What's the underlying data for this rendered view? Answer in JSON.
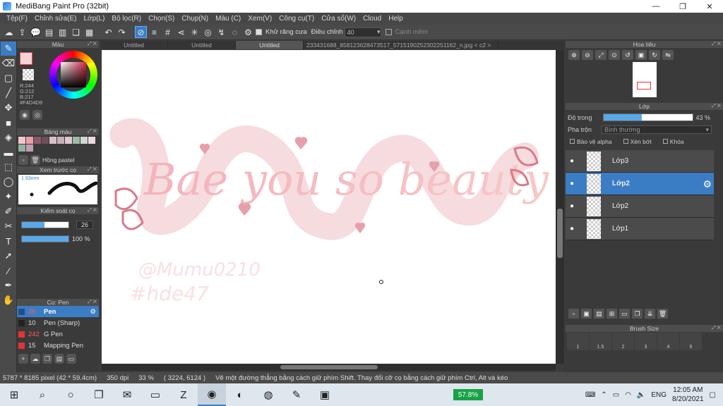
{
  "window": {
    "title": "MediBang Paint Pro (32bit)",
    "minimize": "—",
    "restore": "❐",
    "close": "✕"
  },
  "menu": [
    "Tệp(F)",
    "Chỉnh sửa(E)",
    "Lớp(L)",
    "Bộ lọc(R)",
    "Chọn(S)",
    "Chụp(N)",
    "Màu (C)",
    "Xem(V)",
    "Công cụ(T)",
    "Cửa sổ(W)",
    "Cloud",
    "Help"
  ],
  "toolbar": {
    "antialias_label": "Khử răng cưa",
    "correction_label": "Điều chỉnh",
    "correction_value": "40",
    "snap_label": "Cạnh mềm"
  },
  "panels": {
    "color": {
      "title": "Màu",
      "r": "R:244",
      "g": "G:212",
      "b": "B:217",
      "hex": "#F4D4D9"
    },
    "palette": {
      "title": "Bảng màu",
      "name": "Hồng pastel",
      "swatches": [
        "#f4c6cc",
        "#e8a0a8",
        "#8b5a6a",
        "#6b4f5a",
        "#d8c0c8",
        "#c8b0b8",
        "#e0c8d0",
        "#a0b8a8",
        "#d0d8d0",
        "#f0d8e0",
        "#90b0a0",
        "#c0a0b0"
      ]
    },
    "preview": {
      "title": "Xem trước cọ",
      "size": "1.93mm"
    },
    "control": {
      "title": "Kiểm soát cọ",
      "size_value": "26",
      "size_fraction": 0.48,
      "opacity_value": "100 %",
      "opacity_fraction": 1.0
    },
    "brushes": {
      "title": "Cọ: Pen",
      "items": [
        {
          "size": "26",
          "name": "Pen",
          "color": "#3b7dc4",
          "selected": true
        },
        {
          "size": "10",
          "name": "Pen (Sharp)",
          "color": "#222222",
          "selected": false
        },
        {
          "size": "242",
          "name": "G Pen",
          "color": "#e33333",
          "selected": false
        },
        {
          "size": "15",
          "name": "Mapping Pen",
          "color": "#e33333",
          "selected": false
        }
      ]
    }
  },
  "tabs": [
    {
      "label": "Untitled",
      "active": false
    },
    {
      "label": "Untitled",
      "active": false
    },
    {
      "label": "Untitled",
      "active": true
    },
    {
      "label": "233431688_858123628473517_5715190252302251162_n.jpg < c2 >",
      "active": false
    }
  ],
  "canvas_art": {
    "title_text": "Bae you so beauty",
    "signature": "@Mumu0210",
    "hashtag": "#hde47"
  },
  "right": {
    "navigator_title": "Hoa tiêu",
    "layer_title": "Lớp",
    "opacity_label": "Độ trong",
    "opacity_value": "43 %",
    "opacity_fraction": 0.43,
    "blend_label": "Pha trộn",
    "blend_value": "Bình thường",
    "protect_alpha": "Bảo vệ alpha",
    "clipping": "Xén bớt",
    "lock": "Khóa",
    "layers": [
      {
        "name": "Lớp3",
        "selected": false
      },
      {
        "name": "Lớp2",
        "selected": true
      },
      {
        "name": "Lớp2",
        "selected": false
      },
      {
        "name": "Lớp1",
        "selected": false
      }
    ],
    "brush_size_title": "Brush Size",
    "brush_sizes": [
      "1",
      "1.5",
      "2",
      "3",
      "4",
      "5"
    ]
  },
  "status": {
    "pixels": "5787 * 8185 pixel",
    "cm": "(42 * 59.4cm)",
    "dpi": "350 dpi",
    "zoom": "33 %",
    "coords": "( 3224, 6124 )",
    "hint": "Vẽ một đường thẳng bằng cách giữ phím Shift. Thay đổi cỡ cọ bằng cách giữ phím Ctrl, Alt và kéo"
  },
  "taskbar": {
    "battery": "57.8%",
    "lang": "ENG",
    "time": "12:05 AM",
    "date": "8/20/2021"
  }
}
